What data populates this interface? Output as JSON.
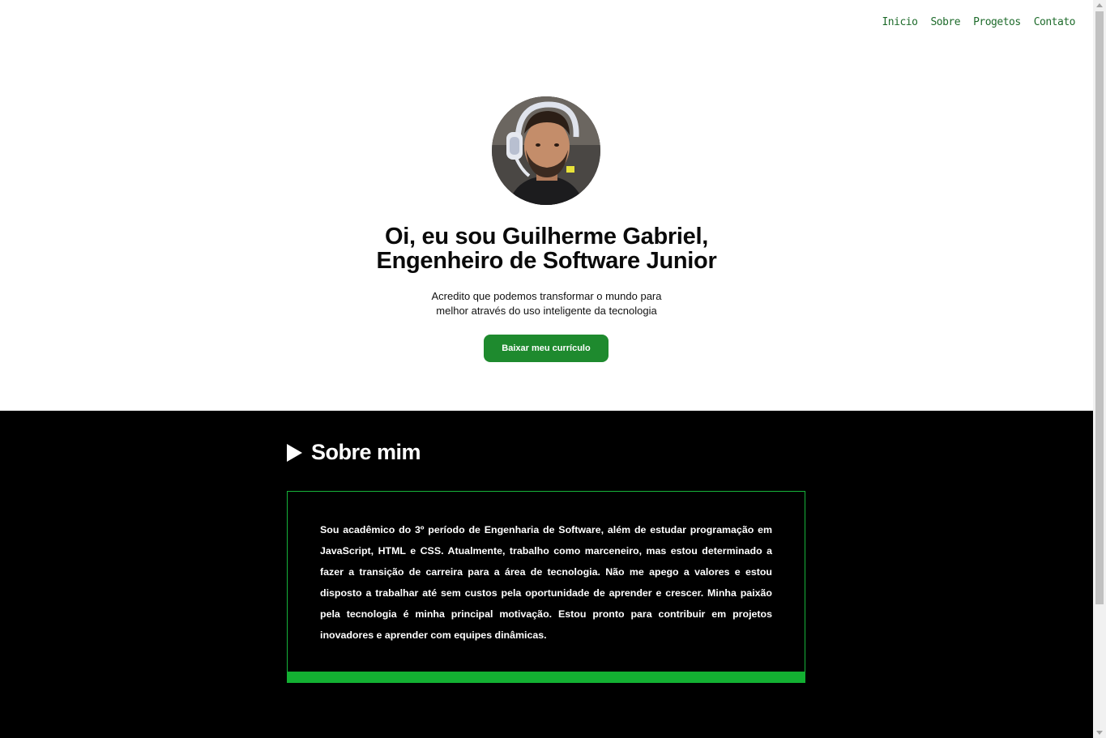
{
  "nav": {
    "items": [
      {
        "label": "Inicio"
      },
      {
        "label": "Sobre"
      },
      {
        "label": "Progetos"
      },
      {
        "label": "Contato"
      }
    ]
  },
  "hero": {
    "headline_line1": "Oi, eu sou Guilherme Gabriel,",
    "headline_line2": "Engenheiro de Software Junior",
    "tagline_line1": "Acredito que podemos transformar o mundo para",
    "tagline_line2": "melhor através do uso inteligente da tecnologia",
    "cv_button": "Baixar meu currículo",
    "avatar_icon": "profile-photo"
  },
  "about": {
    "title": "Sobre mim",
    "title_icon": "play-icon",
    "text": "Sou acadêmico do 3º período de Engenharia de Software, além de estudar programação em JavaScript, HTML e CSS. Atualmente, trabalho como marceneiro, mas estou determinado a fazer a transição de carreira para a área de tecnologia. Não me apego a valores e estou disposto a trabalhar até sem custos pela oportunidade de aprender e crescer. Minha paixão pela tecnologia é minha principal motivação. Estou pronto para contribuir em projetos inovadores e aprender com equipes dinâmicas."
  },
  "colors": {
    "nav_link": "#1e6b2b",
    "button_bg": "#1e8a2e",
    "accent_green": "#13b032",
    "about_bg": "#000000"
  }
}
